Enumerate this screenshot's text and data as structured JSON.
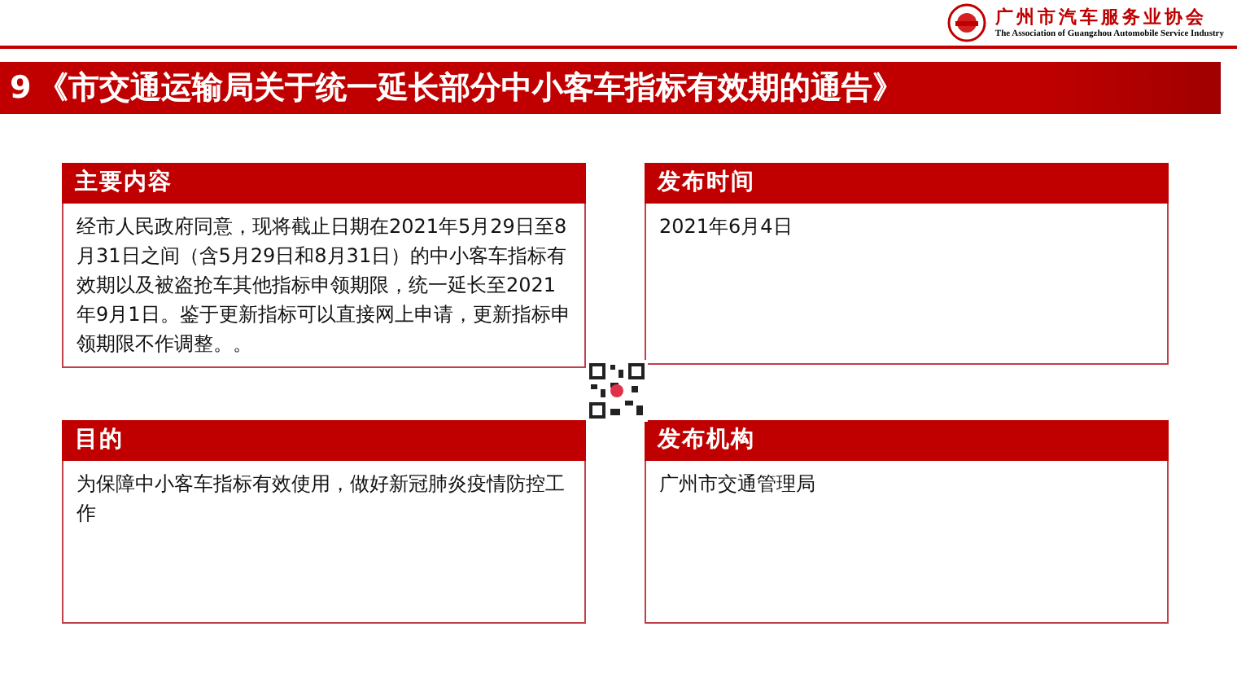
{
  "header": {
    "org_name": "广州市汽车服务业协会",
    "org_name_en": "The Association of Guangzhou Automobile Service Industry"
  },
  "title": {
    "number": "9",
    "text": "《市交通运输局关于统一延长部分中小客车指标有效期的通告》"
  },
  "cards": [
    {
      "heading": "主要内容",
      "body": "经市人民政府同意，现将截止日期在2021年5月29日至8月31日之间（含5月29日和8月31日）的中小客车指标有效期以及被盗抢车其他指标申领期限，统一延长至2021年9月1日。鉴于更新指标可以直接网上申请，更新指标申领期限不作调整。。"
    },
    {
      "heading": "发布时间",
      "body": "2021年6月4日"
    },
    {
      "heading": "目的",
      "body": "为保障中小客车指标有效使用，做好新冠肺炎疫情防控工作"
    },
    {
      "heading": "发布机构",
      "body": "广州市交通管理局"
    }
  ]
}
